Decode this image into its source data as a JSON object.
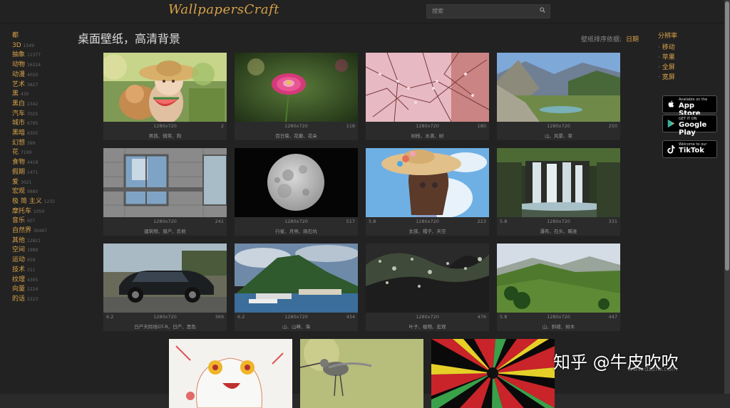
{
  "header": {
    "logo": "WallpapersCraft",
    "search_placeholder": "搜索"
  },
  "page_title": "桌面壁纸，高清背景",
  "sort": {
    "label": "壁纸排序依据:",
    "value": "日期"
  },
  "sidebar": {
    "items": [
      {
        "label": "都",
        "count": ""
      },
      {
        "label": "3D",
        "count": "1549"
      },
      {
        "label": "抽象",
        "count": "11377"
      },
      {
        "label": "动物",
        "count": "16324"
      },
      {
        "label": "动漫",
        "count": "4020"
      },
      {
        "label": "艺术",
        "count": "3827"
      },
      {
        "label": "黑",
        "count": "430"
      },
      {
        "label": "黑白",
        "count": "2342"
      },
      {
        "label": "汽车",
        "count": "7025"
      },
      {
        "label": "城市",
        "count": "6795"
      },
      {
        "label": "黑暗",
        "count": "6305"
      },
      {
        "label": "幻想",
        "count": "399"
      },
      {
        "label": "花",
        "count": "7199"
      },
      {
        "label": "食物",
        "count": "4418"
      },
      {
        "label": "假期",
        "count": "1471"
      },
      {
        "label": "爱",
        "count": "3021"
      },
      {
        "label": "宏观",
        "count": "9880"
      },
      {
        "label": "极 简 主义",
        "count": "1233"
      },
      {
        "label": "摩托车",
        "count": "1050"
      },
      {
        "label": "音乐",
        "count": "607"
      },
      {
        "label": "自然界",
        "count": "30467"
      },
      {
        "label": "其他",
        "count": "12821"
      },
      {
        "label": "空间",
        "count": "1989"
      },
      {
        "label": "运动",
        "count": "659"
      },
      {
        "label": "技术",
        "count": "311"
      },
      {
        "label": "纹理",
        "count": "4305"
      },
      {
        "label": "向量",
        "count": "2224"
      },
      {
        "label": "的话",
        "count": "2223"
      }
    ]
  },
  "resolution": {
    "heading": "分辨率",
    "items": [
      "移动",
      "苹果",
      "全屏",
      "宽屏"
    ]
  },
  "badges": [
    {
      "small": "Available on the",
      "big": "App Store",
      "icon": "apple-icon"
    },
    {
      "small": "GET IT ON",
      "big": "Google Play",
      "icon": "play-icon"
    },
    {
      "small": "Welcome to our",
      "big": "TikTok",
      "icon": "tiktok-icon"
    }
  ],
  "wallpapers": [
    {
      "size": "1280x720",
      "tags": "男孩、微笑、狗",
      "rating": "",
      "comments": "2"
    },
    {
      "size": "1280x720",
      "tags": "百日菊、花瓣、花朵",
      "rating": "",
      "comments": "118"
    },
    {
      "size": "1280x720",
      "tags": "树枝、水滴、树",
      "rating": "",
      "comments": "180"
    },
    {
      "size": "1280x720",
      "tags": "山、风景、草",
      "rating": "",
      "comments": "250"
    },
    {
      "size": "1280x720",
      "tags": "建筑物、窗户、反射",
      "rating": "",
      "comments": "241"
    },
    {
      "size": "1280x720",
      "tags": "行星、月亮、陨石坑",
      "rating": "",
      "comments": "517"
    },
    {
      "size": "1280x720",
      "tags": "女孩、帽子、天空",
      "rating": "5.8",
      "comments": "223"
    },
    {
      "size": "1280x720",
      "tags": "瀑布、石头、瞄准",
      "rating": "5.8",
      "comments": "331"
    },
    {
      "size": "1280x720",
      "tags": "日产天际线GT-R、日产、黑色",
      "rating": "6.2",
      "comments": "369"
    },
    {
      "size": "1280x720",
      "tags": "山、山峰、海",
      "rating": "6.2",
      "comments": "434"
    },
    {
      "size": "1280x720",
      "tags": "叶子、植物、宏观",
      "rating": "",
      "comments": "476"
    },
    {
      "size": "1280x720",
      "tags": "山、斜坡、树木",
      "rating": "5.8",
      "comments": "447"
    }
  ],
  "watermark": {
    "text": "知乎 @牛皮吹吹",
    "site": "www.dzzlw.com"
  }
}
